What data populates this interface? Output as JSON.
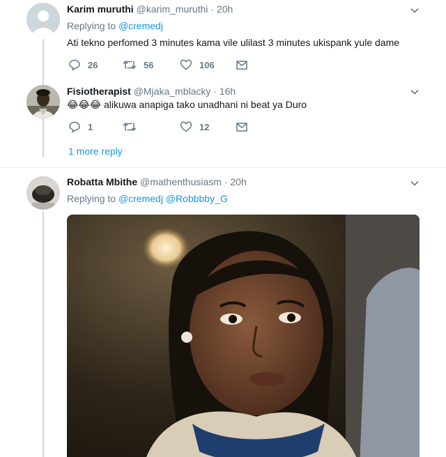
{
  "tweets": [
    {
      "name": "Karim muruthi",
      "handle": "@karim_muruthi",
      "separator": "·",
      "time": "20h",
      "replying_prefix": "Replying to",
      "mentions": [
        "@cremedj"
      ],
      "text": "Ati tekno perfomed 3 minutes kama vile ulilast 3 minutes ukispank yule dame",
      "replies": "26",
      "retweets": "56",
      "likes": "106"
    },
    {
      "name": "Fisiotherapist",
      "handle": "@Mjaka_mblacky",
      "separator": "·",
      "time": "16h",
      "emoji": "😂😂😂",
      "text": " alikuwa anapiga tako unadhani ni beat ya Duro",
      "replies": "1",
      "retweets": "",
      "likes": "12"
    },
    {
      "name": "Robatta Mbithe",
      "handle": "@mathenthusiasm",
      "separator": "·",
      "time": "20h",
      "replying_prefix": "Replying to",
      "mentions": [
        "@cremedj",
        "@Robbbby_G"
      ]
    }
  ],
  "more_replies": "1 more reply",
  "icons": {
    "reply": "reply-icon",
    "retweet": "retweet-icon",
    "like": "heart-icon",
    "dm": "envelope-icon",
    "caret": "chevron-down-icon"
  },
  "colors": {
    "link": "#1b95e0",
    "muted": "#657786",
    "text": "#14171a",
    "thread_line": "#ccd6dd"
  }
}
